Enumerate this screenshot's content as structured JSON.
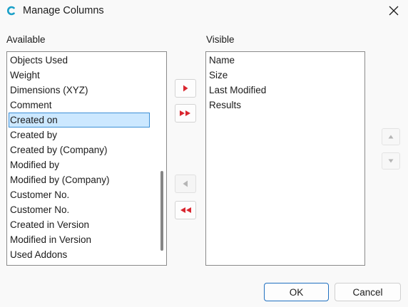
{
  "window": {
    "title": "Manage Columns",
    "app_icon": "c-logo-icon",
    "close_icon": "close-icon"
  },
  "available": {
    "label": "Available",
    "items": [
      {
        "label": "Objects Used"
      },
      {
        "label": "Weight"
      },
      {
        "label": "Dimensions (XYZ)"
      },
      {
        "label": "Comment"
      },
      {
        "label": "Created on",
        "selected": true
      },
      {
        "label": "Created by"
      },
      {
        "label": "Created by (Company)"
      },
      {
        "label": "Modified by"
      },
      {
        "label": "Modified by (Company)"
      },
      {
        "label": "Customer No."
      },
      {
        "label": "Customer No."
      },
      {
        "label": "Created in Version"
      },
      {
        "label": "Modified in Version"
      },
      {
        "label": "Used Addons"
      }
    ]
  },
  "visible": {
    "label": "Visible",
    "items": [
      {
        "label": "Name"
      },
      {
        "label": "Size"
      },
      {
        "label": "Last Modified"
      },
      {
        "label": "Results"
      }
    ]
  },
  "transfer_buttons": {
    "add_icon": "arrow-right-icon",
    "add_all_icon": "double-arrow-right-icon",
    "remove_icon": "arrow-left-icon",
    "remove_all_icon": "double-arrow-left-icon",
    "accent_color": "#d9262f",
    "disabled_color": "#b5b5b5"
  },
  "order_buttons": {
    "up_icon": "arrow-up-icon",
    "down_icon": "arrow-down-icon"
  },
  "dialog_buttons": {
    "ok": "OK",
    "cancel": "Cancel"
  },
  "colors": {
    "selection_bg": "#cce8ff",
    "selection_border": "#3c8fd6",
    "primary_border": "#1f6fbf"
  }
}
